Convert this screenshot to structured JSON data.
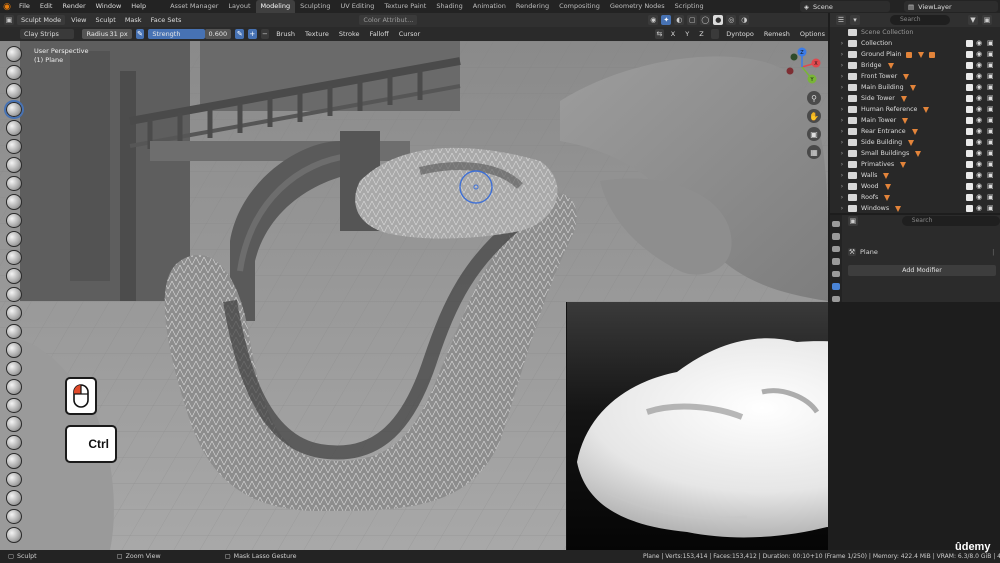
{
  "topbar": {
    "menus": [
      "File",
      "Edit",
      "Render",
      "Window",
      "Help"
    ],
    "workspaces": [
      "Asset Manager",
      "Layout",
      "Modeling",
      "Sculpting",
      "UV Editing",
      "Texture Paint",
      "Shading",
      "Animation",
      "Rendering",
      "Compositing",
      "Geometry Nodes",
      "Scripting"
    ],
    "active_workspace": "Modeling",
    "scene": "Scene",
    "view_layer": "ViewLayer"
  },
  "viewport_header": {
    "mode": "Sculpt Mode",
    "menus": [
      "View",
      "Sculpt",
      "Mask",
      "Face Sets"
    ],
    "color_attribute": "Color Attribut...",
    "dyntopo": "Dyntopo",
    "remesh": "Remesh",
    "options": "Options"
  },
  "tool_settings": {
    "brush": "Clay Strips",
    "radius_label": "Radius",
    "radius_value": "31 px",
    "strength_label": "Strength",
    "strength_value": "0.600",
    "menus": [
      "Brush",
      "Texture",
      "Stroke",
      "Falloff",
      "Cursor"
    ]
  },
  "viewport": {
    "view_name": "User Perspective",
    "object_name": "(1) Plane",
    "key_ctrl": "Ctrl",
    "gizmo_axes": [
      "X",
      "Y",
      "Z"
    ]
  },
  "outliner": {
    "search_placeholder": "Search",
    "root": "Scene Collection",
    "items": [
      {
        "name": "Collection"
      },
      {
        "name": "Ground Plain"
      },
      {
        "name": "Bridge"
      },
      {
        "name": "Front Tower"
      },
      {
        "name": "Main Building"
      },
      {
        "name": "Side Tower"
      },
      {
        "name": "Human Reference"
      },
      {
        "name": "Main Tower"
      },
      {
        "name": "Rear Entrance"
      },
      {
        "name": "Side Building"
      },
      {
        "name": "Small Buildings"
      },
      {
        "name": "Primatives"
      },
      {
        "name": "Walls"
      },
      {
        "name": "Wood"
      },
      {
        "name": "Roofs"
      },
      {
        "name": "Windows"
      }
    ]
  },
  "properties": {
    "search_placeholder": "Search",
    "object_name": "Plane",
    "add_modifier": "Add Modifier"
  },
  "statusbar": {
    "sculpt": "Sculpt",
    "zoom": "Zoom View",
    "mask": "Mask Lasso Gesture",
    "stats": "Plane | Verts:153,414 | Faces:153,412 | Duration: 00:10+10 (Frame 1/250) | Memory: 422.4 MiB | VRAM: 6.3/8.0 GiB | 4.1.0 Beta"
  },
  "watermark": "ûdemy",
  "colors": {
    "accent_blue": "#4772b3",
    "blender_orange": "#e87d0d",
    "object_orange": "#e3843a"
  }
}
